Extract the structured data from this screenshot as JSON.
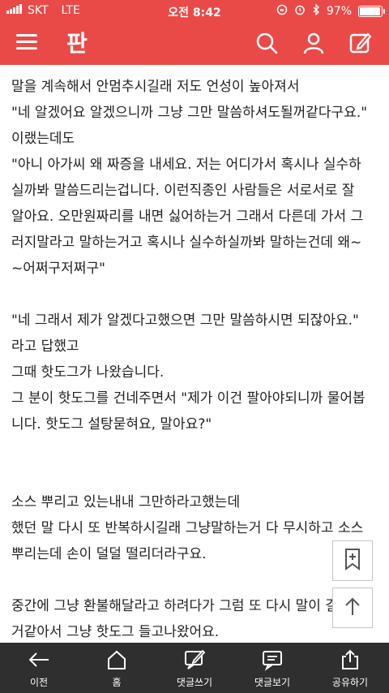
{
  "status_bar": {
    "carrier": "SKT",
    "network": "LTE",
    "time": "오전 8:42",
    "battery": "97%",
    "battery_level": 0.97
  },
  "app": {
    "logo_text": "판"
  },
  "content_lines": [
    "말을 계속해서 안멈추시길래 저도 언성이 높아져서",
    "\"네 알겠어요 알겠으니까 그냥 그만 말씀하셔도될꺼같다구요.\"",
    "이랬는데도",
    "\"아니 아가씨 왜 짜증을 내세요. 저는 어디가서 혹시나 실수하",
    "실까봐 말씀드리는겁니다. 이런직종인 사람들은 서로서로 잘",
    "알아요. 오만원짜리를 내면 싫어하는거 그래서 다른데 가서 그",
    "러지말라고 말하는거고 혹시나 실수하실까봐 말하는건데 왜~",
    "~어쩌구저쩌구\"",
    " \"네 그래서 제가 알겠다고했으면 그만 말씀하시면 되잖아요.\"",
    "라고 답했고",
    "그때 핫도그가 나왔습니다.",
    "그 분이 핫도그를 건네주면서 \"제가 이건 팔아야되니까 물어봅",
    "니다. 핫도그 설탕묻혀요, 말아요?\"",
    "소스 뿌리고 있는내내 그만하라고했는데",
    "했던 말 다시 또 반복하시길래 그냥말하는거 다 무시하고 소스",
    "뿌리는데 손이 덜덜 떨리더라구요.",
    "중간에 그냥 환불해달라고 하려다가 그럼 또 다시 말이 길어질",
    "거같아서 그냥 핫도그 들고나왔어요."
  ],
  "bottom_nav": {
    "back": "이전",
    "home": "홈",
    "write_comment": "댓글쓰기",
    "view_comments": "댓글보기",
    "share": "공유하기"
  },
  "colors": {
    "brand": "#e94a48",
    "bottom_bar": "#2f2f2f"
  }
}
